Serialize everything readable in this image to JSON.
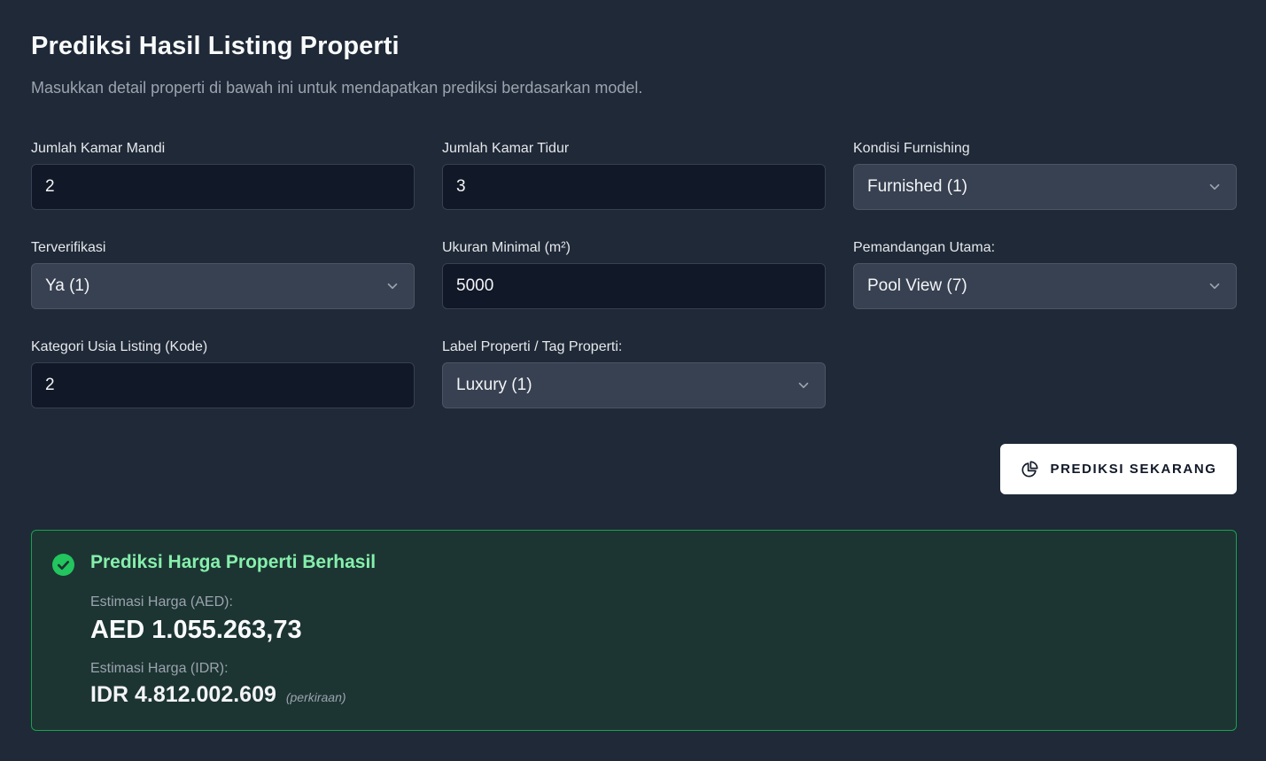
{
  "header": {
    "title": "Prediksi Hasil Listing Properti",
    "subtitle": "Masukkan detail properti di bawah ini untuk mendapatkan prediksi berdasarkan model."
  },
  "form": {
    "bathrooms": {
      "label": "Jumlah Kamar Mandi",
      "value": "2"
    },
    "bedrooms": {
      "label": "Jumlah Kamar Tidur",
      "value": "3"
    },
    "furnishing": {
      "label": "Kondisi Furnishing",
      "selected": "Furnished (1)"
    },
    "verified": {
      "label": "Terverifikasi",
      "selected": "Ya (1)"
    },
    "min_size": {
      "label": "Ukuran Minimal (m²)",
      "value": "5000"
    },
    "main_view": {
      "label": "Pemandangan Utama:",
      "selected": "Pool View (7)"
    },
    "listing_age": {
      "label": "Kategori Usia Listing (Kode)",
      "value": "2"
    },
    "property_tag": {
      "label": "Label Properti / Tag Properti:",
      "selected": "Luxury (1)"
    }
  },
  "actions": {
    "predict_label": "PREDIKSI SEKARANG",
    "predict_icon": "pie-chart-icon"
  },
  "result": {
    "title": "Prediksi Harga Properti Berhasil",
    "status_icon": "check-circle-icon",
    "aed_label": "Estimasi Harga (AED):",
    "aed_value": "AED 1.055.263,73",
    "idr_label": "Estimasi Harga (IDR):",
    "idr_value": "IDR 4.812.002.609",
    "idr_note": "(perkiraan)"
  },
  "colors": {
    "background": "#1f2937",
    "input_bg": "#111827",
    "select_bg": "#374151",
    "success_border": "#16a34a",
    "success_text": "#86efac",
    "success_icon": "#22c55e",
    "result_bg": "#1c3532"
  }
}
